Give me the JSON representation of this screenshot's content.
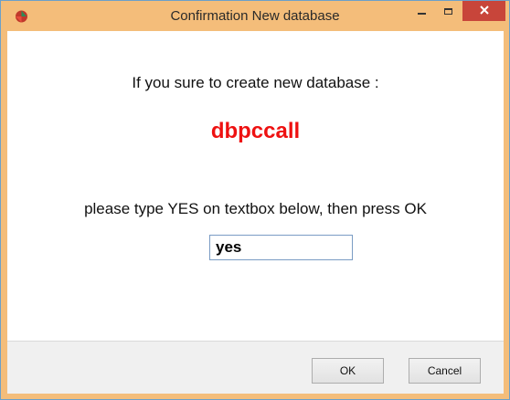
{
  "window": {
    "title": "Confirmation New database",
    "icon": "app-icon",
    "controls": {
      "minimize_icon": "minimize-icon",
      "maximize_icon": "maximize-icon",
      "close_icon": "close-icon"
    },
    "titlebar_color": "#f4bd7a",
    "close_color": "#c8453a"
  },
  "message": {
    "line1": "If you sure to create new database :",
    "database_name": "dbpccall",
    "database_name_color": "#ee1111",
    "line2": "please type YES on textbox below, then press OK"
  },
  "input": {
    "value": "yes"
  },
  "buttons": {
    "ok_label": "OK",
    "cancel_label": "Cancel"
  }
}
